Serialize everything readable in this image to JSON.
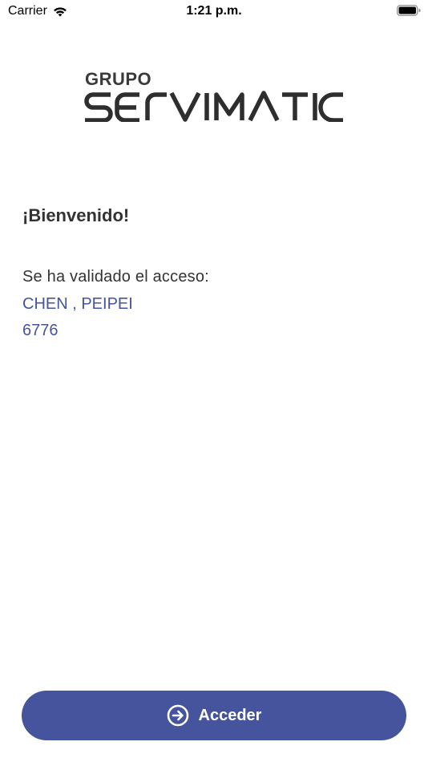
{
  "status_bar": {
    "carrier": "Carrier",
    "time": "1:21 p.m.",
    "icons": [
      "wifi-icon",
      "battery-icon"
    ]
  },
  "logo": {
    "top_text": "GRUPO",
    "main_text": "SERVIMATIC"
  },
  "content": {
    "welcome": "¡Bienvenido!",
    "access_label": "Se ha validado el acceso:",
    "user_name": "CHEN , PEIPEI",
    "user_code": "6776"
  },
  "button": {
    "label": "Acceder",
    "icon": "arrow-right-circle-icon"
  },
  "colors": {
    "accent": "#45549c",
    "text": "#333333",
    "background": "#ffffff"
  }
}
